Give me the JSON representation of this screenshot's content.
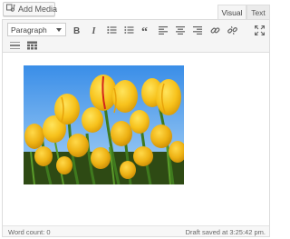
{
  "header": {
    "add_media_label": "Add Media",
    "add_media_icon": "media-icon",
    "tabs": [
      {
        "label": "Visual",
        "active": true
      },
      {
        "label": "Text",
        "active": false
      }
    ]
  },
  "toolbar": {
    "format_select_value": "Paragraph",
    "buttons_row1": [
      "bold-icon",
      "italic-icon",
      "bullet-list-icon",
      "numbered-list-icon",
      "blockquote-icon",
      "align-left-icon",
      "align-center-icon",
      "align-right-icon",
      "link-icon",
      "unlink-icon",
      "fullscreen-icon"
    ],
    "buttons_row2": [
      "horizontal-rule-icon",
      "toolbar-toggle-icon"
    ]
  },
  "content": {
    "image": "tulips-photo"
  },
  "status": {
    "word_count": "Word count: 0",
    "draft_saved": "Draft saved at 3:25:42 pm."
  }
}
